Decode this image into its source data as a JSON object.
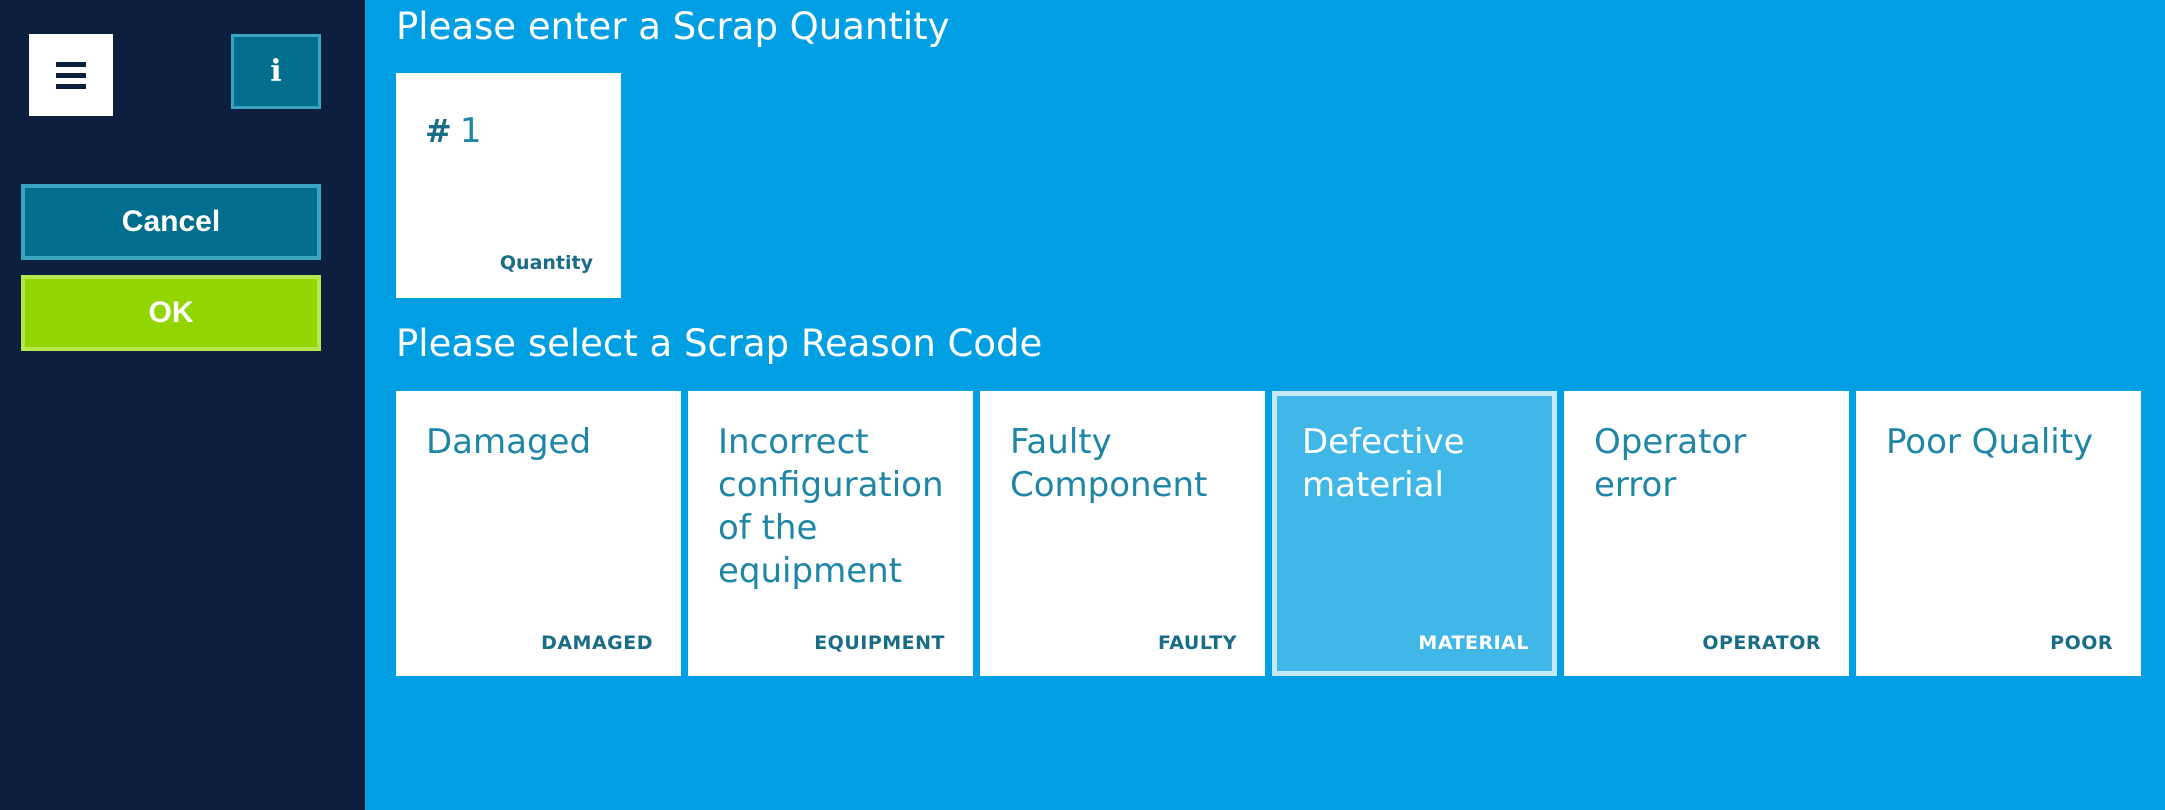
{
  "sidebar": {
    "menu_icon": "hamburger-icon",
    "info_icon": "info-icon",
    "info_glyph": "i",
    "cancel_label": "Cancel",
    "ok_label": "OK"
  },
  "quantity_section": {
    "title": "Please enter a Scrap Quantity",
    "prefix": "#",
    "value": "1",
    "label": "Quantity"
  },
  "reason_section": {
    "title": "Please select a Scrap Reason Code",
    "selected_index": 3,
    "items": [
      {
        "name": "Damaged",
        "code": "DAMAGED"
      },
      {
        "name": "Incorrect configuration of the equipment",
        "code": "EQUIPMENT"
      },
      {
        "name": "Faulty Component",
        "code": "FAULTY"
      },
      {
        "name": "Defective material",
        "code": "MATERIAL"
      },
      {
        "name": "Operator error",
        "code": "OPERATOR"
      },
      {
        "name": "Poor Quality",
        "code": "POOR"
      }
    ]
  },
  "colors": {
    "background": "#009fe3",
    "sidebar": "#0d1f3e",
    "cancel": "#006e8c",
    "ok": "#93d500",
    "selected_tile": "#40b7e7",
    "tile_text": "#1f86a5"
  }
}
